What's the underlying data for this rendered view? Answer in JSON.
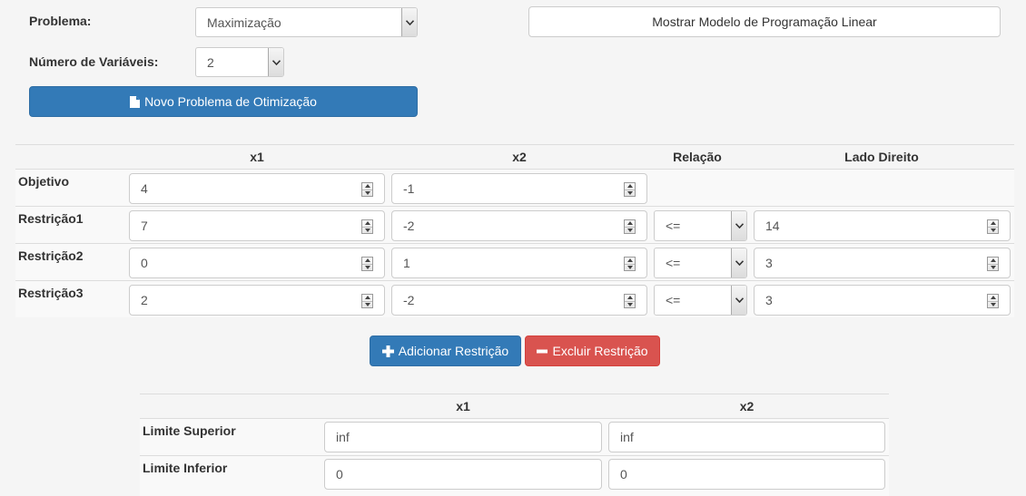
{
  "form": {
    "problem_label": "Problema:",
    "problem_value": "Maximização",
    "numvars_label": "Número de Variáveis:",
    "numvars_value": "2",
    "new_problem_button": "Novo Problema de Otimização",
    "show_model_button": "Mostrar Modelo de Programação Linear"
  },
  "main_table": {
    "headers": [
      "x1",
      "x2",
      "Relação",
      "Lado Direito"
    ],
    "objective": {
      "label": "Objetivo",
      "x1": "4",
      "x2": "-1"
    },
    "constraints": [
      {
        "label": "Restrição1",
        "x1": "7",
        "x2": "-2",
        "relation": "<=",
        "rhs": "14"
      },
      {
        "label": "Restrição2",
        "x1": "0",
        "x2": "1",
        "relation": "<=",
        "rhs": "3"
      },
      {
        "label": "Restrição3",
        "x1": "2",
        "x2": "-2",
        "relation": "<=",
        "rhs": "3"
      }
    ]
  },
  "actions": {
    "add_constraint": "Adicionar Restrição",
    "remove_constraint": "Excluir Restrição"
  },
  "bounds_table": {
    "headers": [
      "x1",
      "x2"
    ],
    "upper": {
      "label": "Limite Superior",
      "x1": "inf",
      "x2": "inf"
    },
    "lower": {
      "label": "Limite Inferior",
      "x1": "0",
      "x2": "0"
    }
  },
  "colors": {
    "primary": "#337ab7",
    "danger": "#d9534f",
    "background": "#f5f5f5"
  },
  "icons": {
    "new_problem": "file-icon",
    "add": "plus-icon",
    "remove": "minus-icon"
  }
}
